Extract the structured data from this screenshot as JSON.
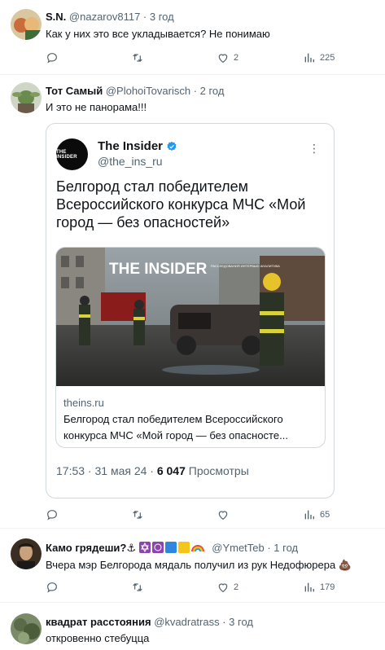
{
  "posts": [
    {
      "name": "S.N.",
      "handle": "@nazarov8117 · 3 год",
      "text": "Как у них это все укладывается? Не понимаю",
      "actions": {
        "replies": "",
        "reposts": "",
        "likes": "2",
        "views": "225"
      }
    },
    {
      "name": "Тот Самый",
      "handle": "@PlohoiTovarisch · 2 год",
      "text": "И это не панорама!!!",
      "actions": {
        "replies": "",
        "reposts": "",
        "likes": "",
        "views": "65"
      },
      "quote": {
        "name": "The Insider",
        "avatar_text": "THE INSIDER",
        "handle": "@the_ins_ru",
        "text": "Белгород стал победителем Всероссийского конкурса МЧС «Мой город — без опасностей»",
        "link": {
          "image_caption": "THE INSIDER",
          "image_subcaption": "РАССЛЕДОВАНИЯ ИНТЕРВЬЮ АНАЛИТИКА",
          "domain": "theins.ru",
          "title": "Белгород стал победителем Всероссийского конкурса МЧС «Мой город — без опасносте..."
        },
        "meta_time": "17:53 · 31 мая 24 · ",
        "meta_views": "6 047",
        "meta_views_label": " Просмотры"
      }
    },
    {
      "name": "Камо грядеши?⚓",
      "handle": "@YmetTeb · 1 год",
      "text": "Вчера мэр Белгорода мядаль получил из рук Недофюрера 💩",
      "actions": {
        "replies": "",
        "reposts": "",
        "likes": "2",
        "views": "179"
      }
    },
    {
      "name": "квадрат расстояния",
      "handle": "@kvadratrass · 3 год",
      "text": "откровенно стебуцца"
    }
  ]
}
